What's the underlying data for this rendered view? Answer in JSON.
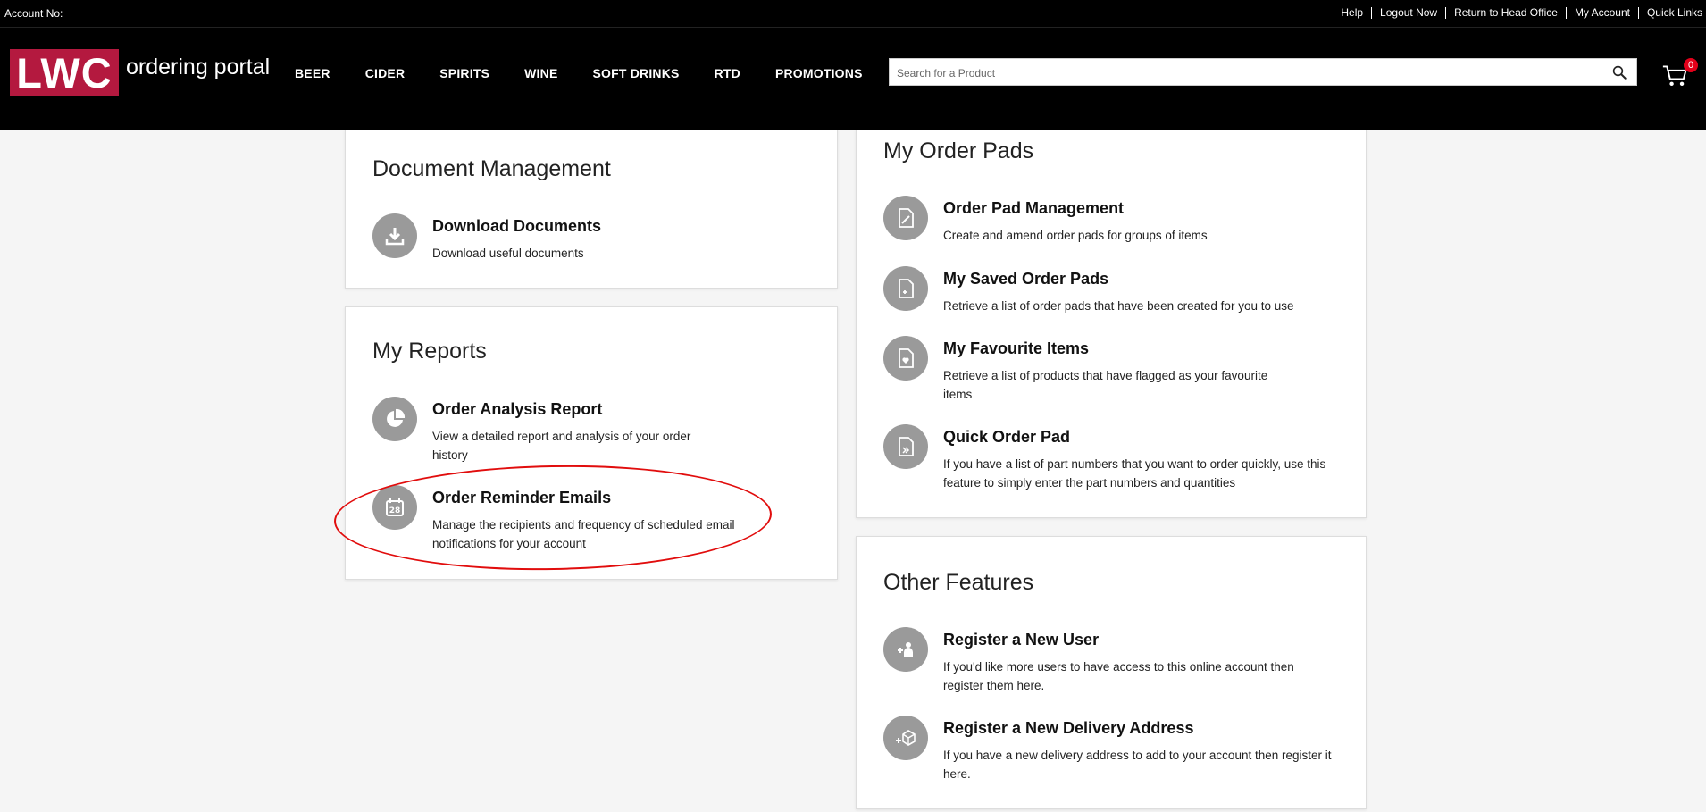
{
  "topbar": {
    "account_label": "Account No:",
    "links": [
      "Help",
      "Logout Now",
      "Return to Head Office",
      "My Account",
      "Quick Links"
    ]
  },
  "header": {
    "logo": "LWC",
    "logo_text": "ordering portal",
    "nav": [
      "BEER",
      "CIDER",
      "SPIRITS",
      "WINE",
      "SOFT DRINKS",
      "RTD",
      "PROMOTIONS"
    ],
    "search_placeholder": "Search for a Product",
    "cart_count": "0"
  },
  "document_management": {
    "title": "Document Management",
    "items": [
      {
        "title": "Download Documents",
        "desc": "Download useful documents",
        "icon": "download-icon"
      }
    ]
  },
  "my_reports": {
    "title": "My Reports",
    "items": [
      {
        "title": "Order Analysis Report",
        "desc": "View a detailed report and analysis of your order history",
        "icon": "pie-chart-icon"
      },
      {
        "title": "Order Reminder Emails",
        "desc": "Manage the recipients and frequency of scheduled email notifications for your account",
        "icon": "calendar-icon"
      }
    ]
  },
  "my_order_pads": {
    "title": "My Order Pads",
    "items": [
      {
        "title": "Order Pad Management",
        "desc": "Create and amend order pads for groups of items",
        "icon": "edit-document-icon"
      },
      {
        "title": "My Saved Order Pads",
        "desc": "Retrieve a list of order pads that have been created for you to use",
        "icon": "document-add-icon"
      },
      {
        "title": "My Favourite Items",
        "desc": "Retrieve a list of products that have flagged as your favourite items",
        "icon": "document-heart-icon"
      },
      {
        "title": "Quick Order Pad",
        "desc": "If you have a list of part numbers that you want to order quickly, use this feature to simply enter the part numbers and quantities",
        "icon": "document-fast-icon"
      }
    ]
  },
  "other_features": {
    "title": "Other Features",
    "items": [
      {
        "title": "Register a New User",
        "desc": "If you'd like more users to have access to this online account then register them here.",
        "icon": "add-user-icon"
      },
      {
        "title": "Register a New Delivery Address",
        "desc": "If you have a new delivery address to add to your account then register it here.",
        "icon": "add-box-icon"
      }
    ]
  },
  "colors": {
    "brand": "#b4193f",
    "header_bg": "#000000",
    "icon_circle": "#9a9a9a",
    "highlight": "#e10d0d",
    "cart_badge": "#e2001a"
  }
}
